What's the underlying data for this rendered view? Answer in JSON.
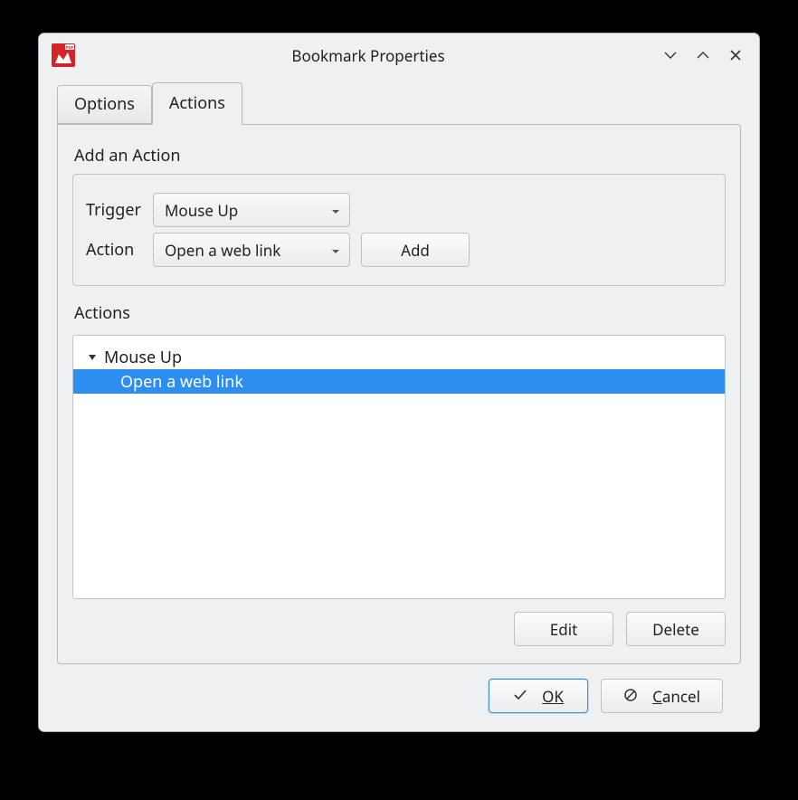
{
  "window": {
    "title": "Bookmark Properties"
  },
  "tabs": {
    "options": "Options",
    "actions": "Actions"
  },
  "addAction": {
    "heading": "Add an Action",
    "triggerLabel": "Trigger",
    "triggerValue": "Mouse Up",
    "actionLabel": "Action",
    "actionValue": "Open a web link",
    "addButton": "Add"
  },
  "actionsList": {
    "heading": "Actions",
    "parent": "Mouse Up",
    "child": "Open a web link",
    "editButton": "Edit",
    "deleteButton": "Delete"
  },
  "dialog": {
    "ok": "OK",
    "cancel": "Cancel"
  }
}
